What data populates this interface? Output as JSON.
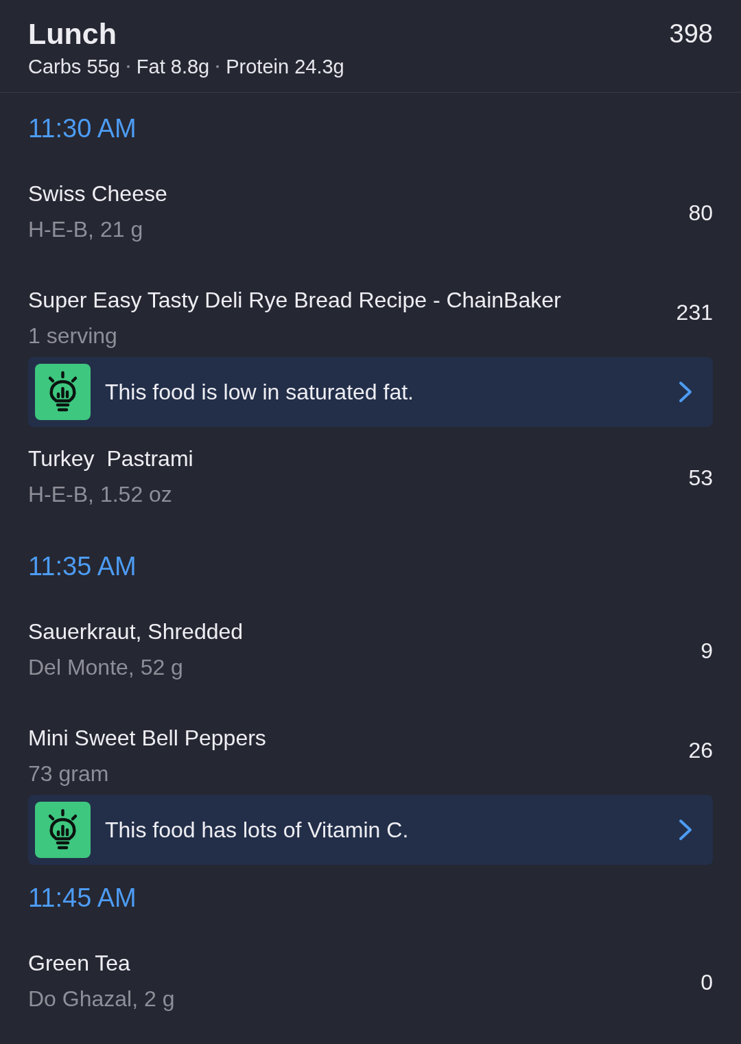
{
  "meal": {
    "title": "Lunch",
    "calories": "398",
    "macros": [
      "Carbs 55g",
      "Fat 8.8g",
      "Protein 24.3g"
    ]
  },
  "groups": [
    {
      "time": "11:30 AM",
      "foods": [
        {
          "name": "Swiss Cheese",
          "detail": "H-E-B, 21 g",
          "calories": "80"
        },
        {
          "name": "Super Easy Tasty Deli Rye Bread Recipe - ChainBaker",
          "detail": "1 serving",
          "calories": "231",
          "tip": "This food is low in saturated fat."
        },
        {
          "name": "Turkey  Pastrami",
          "detail": "H-E-B, 1.52 oz",
          "calories": "53"
        }
      ]
    },
    {
      "time": "11:35 AM",
      "foods": [
        {
          "name": "Sauerkraut, Shredded",
          "detail": "Del Monte, 52 g",
          "calories": "9"
        },
        {
          "name": "Mini Sweet Bell Peppers",
          "detail": "73 gram",
          "calories": "26",
          "tip": "This food has lots of Vitamin C."
        }
      ]
    },
    {
      "time": "11:45 AM",
      "foods": [
        {
          "name": "Green Tea",
          "detail": "Do Ghazal, 2 g",
          "calories": "0"
        }
      ]
    }
  ]
}
